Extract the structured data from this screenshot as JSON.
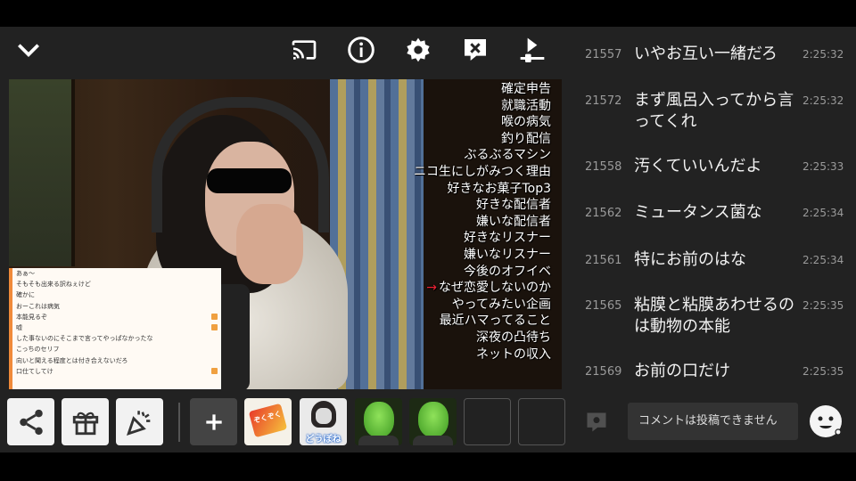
{
  "video": {
    "topics": [
      "確定申告",
      "就職活動",
      "喉の病気",
      "釣り配信",
      "ぶるぶるマシン",
      "ニコ生にしがみつく理由",
      "好きなお菓子Top3",
      "好きな配信者",
      "嫌いな配信者",
      "好きなリスナー",
      "嫌いなリスナー",
      "今後のオフイベ",
      "なぜ恋愛しないのか",
      "やってみたい企画",
      "最近ハマってること",
      "深夜の凸待ち",
      "ネットの収入"
    ],
    "active_topic_index": 12,
    "overlay_comments": [
      "あぁ～",
      "そもそも出来る訳ねぇけど",
      "確かに",
      "おーこれは病気",
      "本能見るぞ",
      "嘘",
      "した事ないのにそこまで言ってやっぱなかったな",
      "こっちのセリフ",
      "向いと聞える程度とは付き合えないだろ",
      "口仕てしてけ"
    ]
  },
  "bottom": {
    "slots": [
      {
        "type": "item",
        "label": "ぞくぞく"
      },
      {
        "type": "item",
        "label": "どうぼね"
      },
      {
        "type": "item",
        "label": ""
      },
      {
        "type": "item",
        "label": ""
      },
      {
        "type": "empty",
        "label": ""
      },
      {
        "type": "empty",
        "label": ""
      }
    ]
  },
  "chat": {
    "comments": [
      {
        "num": "21557",
        "msg": "いやお互い一緒だろ",
        "time": "2:25:32"
      },
      {
        "num": "21572",
        "msg": "まず風呂入ってから言ってくれ",
        "time": "2:25:32"
      },
      {
        "num": "21558",
        "msg": "汚くていいんだよ",
        "time": "2:25:33"
      },
      {
        "num": "21562",
        "msg": "ミュータンス菌な",
        "time": "2:25:34"
      },
      {
        "num": "21561",
        "msg": "特にお前のはな",
        "time": "2:25:34"
      },
      {
        "num": "21565",
        "msg": "粘膜と粘膜あわせるのは動物の本能",
        "time": "2:25:35"
      },
      {
        "num": "21569",
        "msg": "お前の口だけ",
        "time": "2:25:35"
      }
    ],
    "input_placeholder": "コメントは投稿できません"
  },
  "colors": {
    "accent": "#f08a3a",
    "active_arrow": "#e23",
    "background": "#202020"
  }
}
